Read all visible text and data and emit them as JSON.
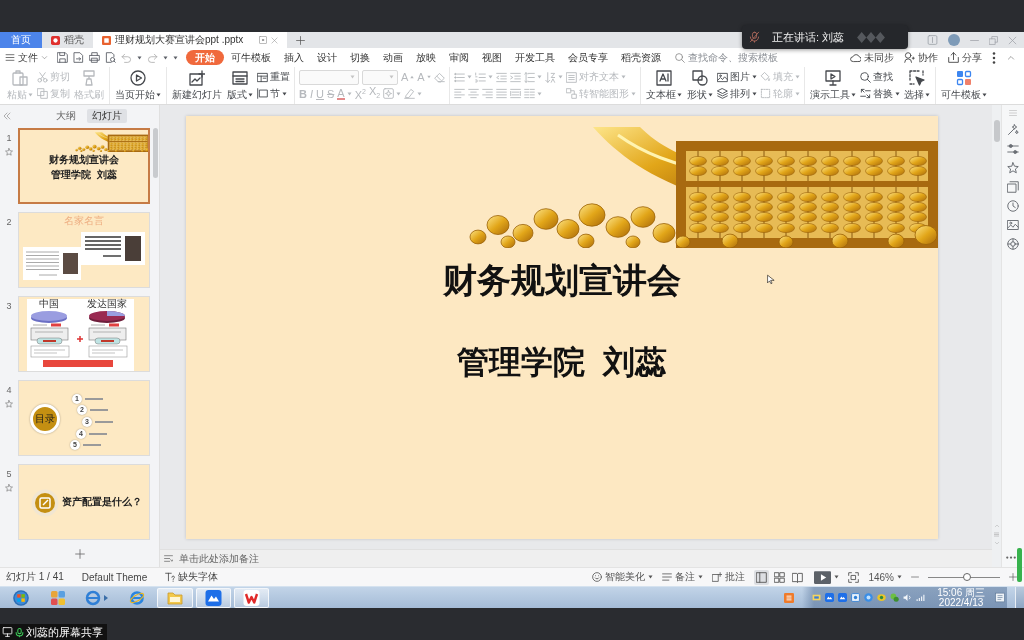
{
  "speaker_toast": {
    "text": "正在讲话: 刘蕊"
  },
  "tab_bar": {
    "tabs": [
      {
        "kind": "home",
        "label": "首页",
        "selected": false
      },
      {
        "kind": "docer",
        "label": "稻壳",
        "selected": false
      },
      {
        "kind": "document",
        "label": "理财规划大赛宣讲会ppt .pptx",
        "selected": true
      }
    ]
  },
  "menu_bar": {
    "file_menu": "文件",
    "tabs": [
      {
        "label": "开始",
        "selected": true
      },
      {
        "label": "可牛模板",
        "selected": false
      },
      {
        "label": "插入",
        "selected": false
      },
      {
        "label": "设计",
        "selected": false
      },
      {
        "label": "切换",
        "selected": false
      },
      {
        "label": "动画",
        "selected": false
      },
      {
        "label": "放映",
        "selected": false
      },
      {
        "label": "审阅",
        "selected": false
      },
      {
        "label": "视图",
        "selected": false
      },
      {
        "label": "开发工具",
        "selected": false
      },
      {
        "label": "会员专享",
        "selected": false
      },
      {
        "label": "稻壳资源",
        "selected": false
      }
    ],
    "search": {
      "placeholder": "查找命令、搜索模板"
    },
    "actions": [
      {
        "kind": "sync",
        "label": "未同步"
      },
      {
        "kind": "collaborate",
        "label": "协作"
      },
      {
        "kind": "share",
        "label": "分享"
      }
    ]
  },
  "ribbon": {
    "groups": [
      {
        "columns": [
          [
            [
              {
                "kind": "paste",
                "label": "粘贴",
                "dropdown": true,
                "disabled": true
              }
            ]
          ],
          [
            [
              {
                "kind": "cut",
                "label": "剪切",
                "dropdown": false,
                "disabled": true
              }
            ],
            [
              {
                "kind": "copy",
                "label": "复制",
                "dropdown": false,
                "disabled": true
              }
            ]
          ],
          [
            [
              {
                "kind": "format_painter",
                "label": "格式刷",
                "dropdown": false,
                "disabled": true
              }
            ]
          ]
        ]
      },
      {
        "columns": [
          [
            [
              {
                "kind": "play",
                "label": "当页开始",
                "dropdown": true,
                "disabled": false
              }
            ]
          ]
        ]
      },
      {
        "columns": [
          [
            [
              {
                "kind": "new_slide",
                "label": "新建幻灯片",
                "dropdown": false,
                "disabled": false
              }
            ]
          ],
          [
            [
              {
                "kind": "layout",
                "label": "版式",
                "dropdown": true,
                "disabled": false
              }
            ]
          ],
          [
            [
              {
                "kind": "reset",
                "label": "重置",
                "dropdown": false,
                "disabled": false
              }
            ],
            [
              {
                "kind": "section",
                "label": "节",
                "dropdown": true,
                "disabled": false
              }
            ]
          ]
        ]
      },
      {
        "columns": [
          [
            [
              {
                "kind": "font_name",
                "dropdown": true,
                "disabled": true
              },
              {
                "kind": "font_size",
                "dropdown": true,
                "disabled": true
              },
              {
                "kind": "grow_font",
                "label": "A",
                "dropdown": false,
                "disabled": true
              },
              {
                "kind": "shrink_font",
                "label": "A",
                "dropdown": false,
                "disabled": true
              },
              {
                "kind": "clear_format",
                "dropdown": false,
                "disabled": true
              }
            ],
            [
              {
                "kind": "bold",
                "label": "B",
                "dropdown": false,
                "disabled": true
              },
              {
                "kind": "italic",
                "label": "I",
                "dropdown": false,
                "disabled": true
              },
              {
                "kind": "underline",
                "label": "U",
                "dropdown": false,
                "disabled": true
              },
              {
                "kind": "strike",
                "label": "S",
                "dropdown": false,
                "disabled": true
              },
              {
                "kind": "font_color",
                "label": "A",
                "dropdown": true,
                "disabled": true
              },
              {
                "kind": "superscript",
                "label": "X$^{2}$",
                "dropdown": false,
                "disabled": true
              },
              {
                "kind": "subscript",
                "label": "X$_{2}$",
                "dropdown": false,
                "disabled": true
              },
              {
                "kind": "text_effect",
                "dropdown": true,
                "disabled": true
              },
              {
                "kind": "highlight",
                "dropdown": true,
                "disabled": true
              }
            ]
          ]
        ]
      },
      {
        "columns": [
          [
            [
              {
                "kind": "bullets",
                "dropdown": true,
                "disabled": true
              },
              {
                "kind": "numbering",
                "dropdown": true,
                "disabled": true
              },
              {
                "kind": "outdent",
                "dropdown": false,
                "disabled": true
              },
              {
                "kind": "indent",
                "dropdown": false,
                "disabled": true
              },
              {
                "kind": "line_spacing",
                "dropdown": true,
                "disabled": true
              },
              {
                "kind": "sort",
                "dropdown": true,
                "disabled": true
              }
            ],
            [
              {
                "kind": "align_left",
                "dropdown": false,
                "disabled": true
              },
              {
                "kind": "align_center",
                "dropdown": false,
                "disabled": true
              },
              {
                "kind": "align_right",
                "dropdown": false,
                "disabled": true
              },
              {
                "kind": "justify",
                "dropdown": false,
                "disabled": true
              },
              {
                "kind": "distribute",
                "dropdown": false,
                "disabled": true
              },
              {
                "kind": "columns",
                "dropdown": true,
                "disabled": true
              }
            ]
          ],
          [
            [
              {
                "kind": "align_text",
                "label": "对齐文本",
                "dropdown": true,
                "disabled": true
              }
            ],
            [
              {
                "kind": "smart_graphic",
                "label": "转智能图形",
                "dropdown": true,
                "disabled": true
              }
            ]
          ]
        ]
      },
      {
        "columns": [
          [
            [
              {
                "kind": "text_box",
                "label": "文本框",
                "dropdown": true,
                "disabled": false
              }
            ]
          ],
          [
            [
              {
                "kind": "shapes",
                "label": "形状",
                "dropdown": true,
                "disabled": false
              }
            ]
          ],
          [
            [
              {
                "kind": "picture",
                "label": "图片",
                "dropdown": true,
                "disabled": false
              }
            ],
            [
              {
                "kind": "arrange",
                "label": "排列",
                "dropdown": true,
                "disabled": false
              }
            ]
          ],
          [
            [
              {
                "kind": "fill",
                "label": "填充",
                "dropdown": true,
                "disabled": true
              }
            ],
            [
              {
                "kind": "outline",
                "label": "轮廓",
                "dropdown": true,
                "disabled": true
              }
            ]
          ]
        ]
      },
      {
        "columns": [
          [
            [
              {
                "kind": "presentation_tools",
                "label": "演示工具",
                "dropdown": true,
                "disabled": false
              }
            ]
          ],
          [
            [
              {
                "kind": "find",
                "label": "查找",
                "dropdown": false,
                "disabled": false
              }
            ],
            [
              {
                "kind": "replace",
                "label": "替换",
                "dropdown": true,
                "disabled": false
              }
            ]
          ],
          [
            [
              {
                "kind": "select",
                "label": "选择",
                "dropdown": true,
                "disabled": false
              }
            ]
          ]
        ]
      },
      {
        "columns": [
          [
            [
              {
                "kind": "template",
                "label": "可牛模板",
                "dropdown": true,
                "disabled": false
              }
            ]
          ]
        ]
      }
    ]
  },
  "slide_panel": {
    "view_tabs": [
      {
        "label": "大纲",
        "selected": false
      },
      {
        "label": "幻灯片",
        "selected": true
      }
    ],
    "thumbnails": [
      {
        "number": "1",
        "selected": true,
        "animated": true,
        "kind": "title",
        "title": "财务规划宣讲会",
        "subtitle": "管理学院  刘蕊"
      },
      {
        "number": "2",
        "selected": false,
        "animated": false,
        "kind": "quotes",
        "title": "名家名言"
      },
      {
        "number": "3",
        "selected": false,
        "animated": false,
        "kind": "comparison",
        "labels": [
          "中国",
          "发达国家"
        ]
      },
      {
        "number": "4",
        "selected": false,
        "animated": true,
        "kind": "contents",
        "badge": "目录",
        "items": [
          "1",
          "2",
          "3",
          "4",
          "5"
        ]
      },
      {
        "number": "5",
        "selected": false,
        "animated": true,
        "kind": "section",
        "title": "资产配置是什么？"
      }
    ]
  },
  "slide": {
    "title": "财务规划宣讲会",
    "subtitle": "管理学院  刘蕊"
  },
  "notes": {
    "placeholder": "单击此处添加备注"
  },
  "status_bar": {
    "slide_position": "幻灯片 1 / 41",
    "theme": "Default Theme",
    "missing_fonts": "缺失字体",
    "beautify": "智能美化",
    "notes": "备注",
    "comments": "批注",
    "views": [
      {
        "kind": "normal",
        "selected": true
      },
      {
        "kind": "sorter",
        "selected": false
      },
      {
        "kind": "reading",
        "selected": false
      }
    ],
    "zoom": "146%",
    "zoom_slider": {
      "level": 0.55
    }
  },
  "taskbar": {
    "apps": [
      {
        "kind": "start",
        "running": false
      },
      {
        "kind": "tiles",
        "running": false
      },
      {
        "kind": "browser_arrow",
        "running": false
      },
      {
        "kind": "browser",
        "running": false
      },
      {
        "kind": "folder",
        "running": true
      },
      {
        "kind": "meeting",
        "running": true
      },
      {
        "kind": "wps",
        "running": true
      }
    ],
    "time": "15:06 周三",
    "date": "2022/4/13"
  },
  "share_label": {
    "text": "刘蕊的屏幕共享"
  }
}
